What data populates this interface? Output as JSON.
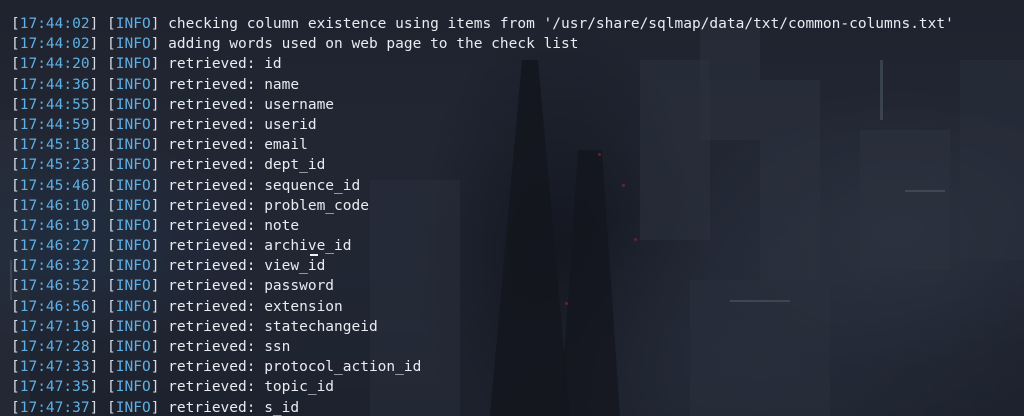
{
  "colors": {
    "timestamp": "#5fb0e6",
    "level": "#5fb0e6",
    "text": "#e8ebf0"
  },
  "log": [
    {
      "time": "17:44:02",
      "level": "INFO",
      "message": "checking column existence using items from '/usr/share/sqlmap/data/txt/common-columns.txt'"
    },
    {
      "time": "17:44:02",
      "level": "INFO",
      "message": "adding words used on web page to the check list"
    },
    {
      "time": "17:44:20",
      "level": "INFO",
      "message": "retrieved: id"
    },
    {
      "time": "17:44:36",
      "level": "INFO",
      "message": "retrieved: name"
    },
    {
      "time": "17:44:55",
      "level": "INFO",
      "message": "retrieved: username"
    },
    {
      "time": "17:44:59",
      "level": "INFO",
      "message": "retrieved: userid"
    },
    {
      "time": "17:45:18",
      "level": "INFO",
      "message": "retrieved: email"
    },
    {
      "time": "17:45:23",
      "level": "INFO",
      "message": "retrieved: dept_id"
    },
    {
      "time": "17:45:46",
      "level": "INFO",
      "message": "retrieved: sequence_id"
    },
    {
      "time": "17:46:10",
      "level": "INFO",
      "message": "retrieved: problem_code"
    },
    {
      "time": "17:46:19",
      "level": "INFO",
      "message": "retrieved: note"
    },
    {
      "time": "17:46:27",
      "level": "INFO",
      "message": "retrieved: archive_id"
    },
    {
      "time": "17:46:32",
      "level": "INFO",
      "message": "retrieved: view_id"
    },
    {
      "time": "17:46:52",
      "level": "INFO",
      "message": "retrieved: password"
    },
    {
      "time": "17:46:56",
      "level": "INFO",
      "message": "retrieved: extension"
    },
    {
      "time": "17:47:19",
      "level": "INFO",
      "message": "retrieved: statechangeid"
    },
    {
      "time": "17:47:28",
      "level": "INFO",
      "message": "retrieved: ssn"
    },
    {
      "time": "17:47:33",
      "level": "INFO",
      "message": "retrieved: protocol_action_id"
    },
    {
      "time": "17:47:35",
      "level": "INFO",
      "message": "retrieved: topic_id"
    },
    {
      "time": "17:47:37",
      "level": "INFO",
      "message": "retrieved: s_id"
    }
  ]
}
